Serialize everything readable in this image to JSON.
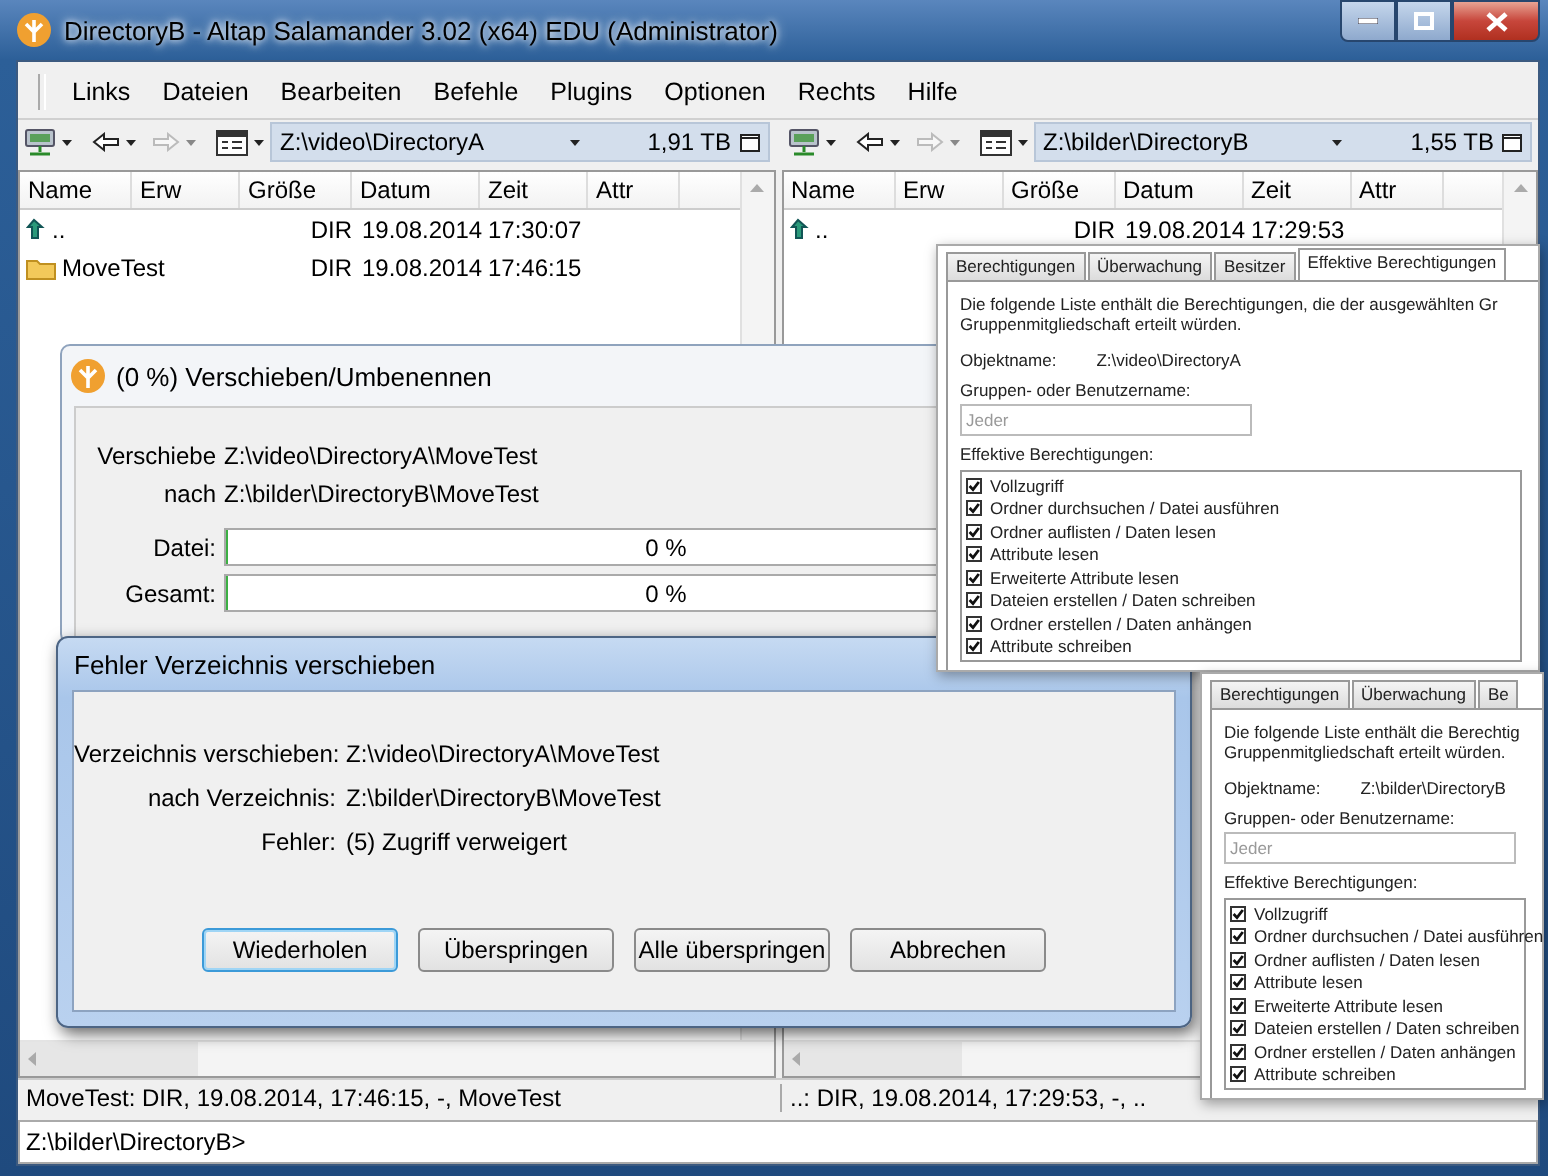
{
  "window": {
    "title": "DirectoryB - Altap Salamander 3.02 (x64) EDU (Administrator)"
  },
  "menu": [
    "Links",
    "Dateien",
    "Bearbeiten",
    "Befehle",
    "Plugins",
    "Optionen",
    "Rechts",
    "Hilfe"
  ],
  "panels": [
    {
      "path": "Z:\\video\\DirectoryA",
      "free_space": "1,91 TB",
      "columns": [
        "Name",
        "Erw",
        "Größe",
        "Datum",
        "Zeit",
        "Attr"
      ],
      "rows": [
        {
          "kind": "up",
          "name": "..",
          "size": "DIR",
          "date": "19.08.2014",
          "time": "17:30:07"
        },
        {
          "kind": "folder",
          "name": "MoveTest",
          "size": "DIR",
          "date": "19.08.2014",
          "time": "17:46:15"
        }
      ],
      "status": "MoveTest: DIR, 19.08.2014, 17:46:15, -, MoveTest"
    },
    {
      "path": "Z:\\bilder\\DirectoryB",
      "free_space": "1,55 TB",
      "columns": [
        "Name",
        "Erw",
        "Größe",
        "Datum",
        "Zeit",
        "Attr"
      ],
      "rows": [
        {
          "kind": "up",
          "name": "..",
          "size": "DIR",
          "date": "19.08.2014",
          "time": "17:29:53"
        }
      ],
      "status": "..: DIR, 19.08.2014, 17:29:53, -, .."
    }
  ],
  "command_line": "Z:\\bilder\\DirectoryB>",
  "progress_dialog": {
    "title": "(0 %) Verschieben/Umbenennen",
    "lines": [
      {
        "label": "Verschiebe",
        "value": "Z:\\video\\DirectoryA\\MoveTest"
      },
      {
        "label": "nach",
        "value": "Z:\\bilder\\DirectoryB\\MoveTest"
      }
    ],
    "bars": [
      {
        "label": "Datei:",
        "level": 0,
        "reading": "0 %"
      },
      {
        "label": "Gesamt:",
        "level": 0,
        "reading": "0 %"
      }
    ]
  },
  "error_dialog": {
    "title": "Fehler Verzeichnis verschieben",
    "lines": [
      {
        "label": "Verzeichnis verschieben:",
        "value": "Z:\\video\\DirectoryA\\MoveTest"
      },
      {
        "label": "nach Verzeichnis:",
        "value": "Z:\\bilder\\DirectoryB\\MoveTest"
      },
      {
        "label": "Fehler:",
        "value": "(5) Zugriff verweigert"
      }
    ],
    "buttons": [
      {
        "label": "Wiederholen",
        "default": true
      },
      {
        "label": "Überspringen",
        "default": false
      },
      {
        "label": "Alle überspringen",
        "default": false
      },
      {
        "label": "Abbrechen",
        "default": false
      }
    ]
  },
  "permission_sheets": [
    {
      "tabs": [
        {
          "label": "Berechtigungen",
          "selected": false
        },
        {
          "label": "Überwachung",
          "selected": false
        },
        {
          "label": "Besitzer",
          "selected": false
        },
        {
          "label": "Effektive Berechtigungen",
          "selected": true
        }
      ],
      "description_lines": [
        "Die folgende Liste enthält die Berechtigungen, die der ausgewählten Gr",
        "Gruppenmitgliedschaft erteilt würden."
      ],
      "object_label": "Objektname:",
      "object_value": "Z:\\video\\DirectoryA",
      "group_label": "Gruppen- oder Benutzername:",
      "group_placeholder": "Jeder",
      "effective_label": "Effektive Berechtigungen:",
      "permissions": [
        {
          "label": "Vollzugriff",
          "checked": true
        },
        {
          "label": "Ordner durchsuchen / Datei ausführen",
          "checked": true
        },
        {
          "label": "Ordner auflisten / Daten lesen",
          "checked": true
        },
        {
          "label": "Attribute lesen",
          "checked": true
        },
        {
          "label": "Erweiterte Attribute lesen",
          "checked": true
        },
        {
          "label": "Dateien erstellen / Daten schreiben",
          "checked": true
        },
        {
          "label": "Ordner erstellen / Daten anhängen",
          "checked": true
        },
        {
          "label": "Attribute schreiben",
          "checked": true
        }
      ]
    },
    {
      "tabs": [
        {
          "label": "Berechtigungen",
          "selected": false
        },
        {
          "label": "Überwachung",
          "selected": false
        },
        {
          "label": "Be",
          "selected": false
        }
      ],
      "description_lines": [
        "Die folgende Liste enthält die Berechtig",
        "Gruppenmitgliedschaft erteilt würden."
      ],
      "object_label": "Objektname:",
      "object_value": "Z:\\bilder\\DirectoryB",
      "group_label": "Gruppen- oder Benutzername:",
      "group_placeholder": "Jeder",
      "effective_label": "Effektive Berechtigungen:",
      "permissions": [
        {
          "label": "Vollzugriff",
          "checked": true
        },
        {
          "label": "Ordner durchsuchen / Datei ausführen",
          "checked": true
        },
        {
          "label": "Ordner auflisten / Daten lesen",
          "checked": true
        },
        {
          "label": "Attribute lesen",
          "checked": true
        },
        {
          "label": "Erweiterte Attribute lesen",
          "checked": true
        },
        {
          "label": "Dateien erstellen / Daten schreiben",
          "checked": true
        },
        {
          "label": "Ordner erstellen / Daten anhängen",
          "checked": true
        },
        {
          "label": "Attribute schreiben",
          "checked": true
        }
      ]
    }
  ]
}
